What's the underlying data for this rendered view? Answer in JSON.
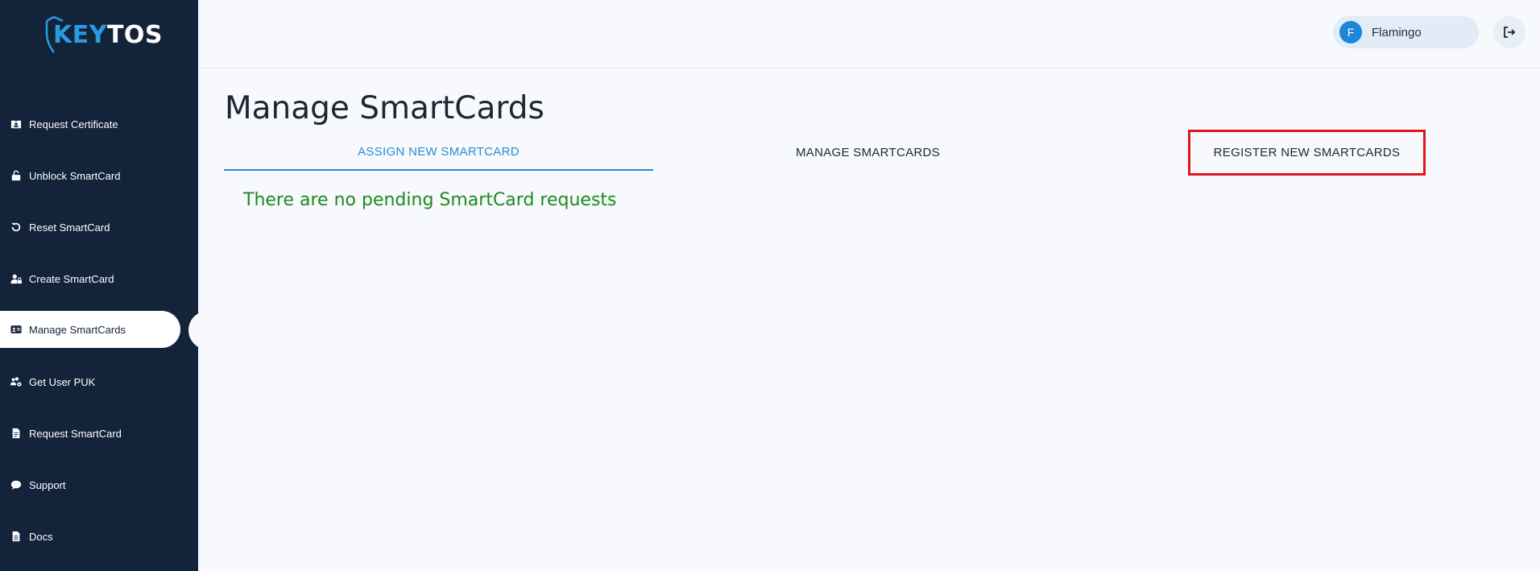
{
  "brand": {
    "logo_part1": "KEY",
    "logo_part2": "TOS",
    "accent_color": "#2b9be0",
    "sidebar_color": "#13233a"
  },
  "sidebar": {
    "items": [
      {
        "label": "Request Certificate",
        "icon": "certificate-icon"
      },
      {
        "label": "Unblock SmartCard",
        "icon": "unlock-icon"
      },
      {
        "label": "Reset SmartCard",
        "icon": "reset-icon"
      },
      {
        "label": "Create SmartCard",
        "icon": "user-lock-icon"
      },
      {
        "label": "Manage SmartCards",
        "icon": "id-card-icon",
        "active": true
      },
      {
        "label": "Get User PUK",
        "icon": "users-gear-icon"
      },
      {
        "label": "Request SmartCard",
        "icon": "document-icon"
      },
      {
        "label": "Support",
        "icon": "chat-icon"
      },
      {
        "label": "Docs",
        "icon": "doc-icon"
      }
    ]
  },
  "header": {
    "user_initial": "F",
    "user_name": "Flamingo",
    "logout_icon": "logout-icon"
  },
  "main": {
    "title": "Manage SmartCards",
    "tabs": [
      {
        "label": "ASSIGN NEW SMARTCARD",
        "active": true
      },
      {
        "label": "MANAGE SMARTCARDS"
      },
      {
        "label": "REGISTER NEW SMARTCARDS",
        "highlighted": true,
        "highlight_color": "#e0161f"
      }
    ],
    "empty_message": "There are no pending SmartCard requests",
    "empty_message_color": "#1d8a1f"
  }
}
